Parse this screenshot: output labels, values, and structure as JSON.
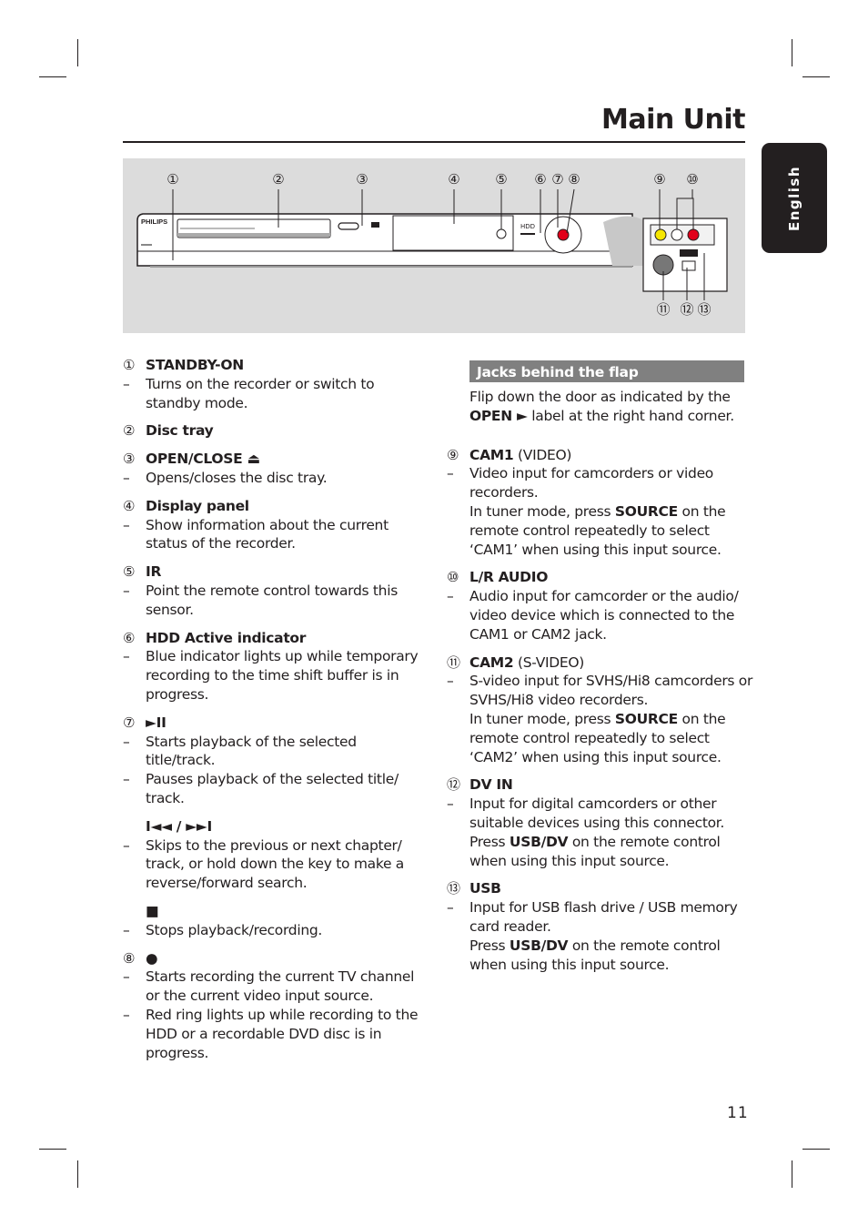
{
  "page": {
    "title": "Main Unit",
    "language_tab": "English",
    "page_number": "11"
  },
  "figure": {
    "brand": "PHILIPS",
    "callouts": [
      "①",
      "②",
      "③",
      "④",
      "⑤",
      "⑥",
      "⑦",
      "⑧",
      "⑨",
      "⑩",
      "⑪",
      "⑫",
      "⑬"
    ],
    "colors": {
      "background": "#dcdcdc",
      "video_jack": "#f5e600",
      "audio_left_jack": "#ffffff",
      "audio_right_jack": "#e2001a",
      "record_button": "#e2001a"
    }
  },
  "left_column": {
    "items": [
      {
        "num": "①",
        "heading": "STANDBY-ON",
        "lines": [
          "Turns on the recorder or switch to standby mode."
        ]
      },
      {
        "num": "②",
        "heading": "Disc tray",
        "lines": []
      },
      {
        "num": "③",
        "heading": "OPEN/CLOSE ⏏",
        "lines": [
          "Opens/closes the disc tray."
        ]
      },
      {
        "num": "④",
        "heading": "Display panel",
        "lines": [
          "Show information about the current status of the recorder."
        ]
      },
      {
        "num": "⑤",
        "heading": "IR",
        "lines": [
          "Point the remote control towards this sensor."
        ]
      },
      {
        "num": "⑥",
        "heading": "HDD Active indicator",
        "lines": [
          "Blue indicator lights up while  temporary recording to the time shift buffer is in progress."
        ]
      },
      {
        "num": "⑦",
        "heading": "►II",
        "lines": [
          "Starts playback of the selected title/track.",
          "Pauses playback of the selected title/ track."
        ],
        "sub1_heading": "I◄◄ / ►►I",
        "sub1_lines": [
          "Skips to the previous or next chapter/ track, or hold down the key to make a reverse/forward search."
        ],
        "sub2_heading": "■",
        "sub2_lines": [
          "Stops playback/recording."
        ]
      },
      {
        "num": "⑧",
        "heading": "●",
        "lines": [
          "Starts recording the current TV channel or the current video input source.",
          "Red ring lights up while recording to the HDD or a recordable DVD disc is in progress."
        ]
      }
    ]
  },
  "right_column": {
    "section_title": "Jacks behind the flap",
    "intro_pre": "Flip down the door as indicated by the",
    "intro_bold": "OPEN ►",
    "intro_post": " label at the right hand corner.",
    "items": [
      {
        "num": "⑨",
        "heading": "CAM1",
        "heading_plain": " (VIDEO)",
        "line": "Video input for camcorders or video recorders.",
        "note_pre": "In tuner mode, press ",
        "note_bold": "SOURCE",
        "note_post": " on the remote control repeatedly to select ‘CAM1’ when using this input source."
      },
      {
        "num": "⑩",
        "heading": "L/R AUDIO",
        "heading_plain": "",
        "line": "Audio input for camcorder or the audio/ video device which is connected to the CAM1 or CAM2 jack."
      },
      {
        "num": "⑪",
        "heading": "CAM2",
        "heading_plain": " (S-VIDEO)",
        "line": "S-video input for SVHS/Hi8 camcorders or SVHS/Hi8 video recorders.",
        "note_pre": "In tuner mode, press ",
        "note_bold": "SOURCE",
        "note_post": " on the remote control repeatedly to select ‘CAM2’ when using this input source."
      },
      {
        "num": "⑫",
        "heading": "DV IN",
        "heading_plain": "",
        "line": "Input for digital camcorders or other suitable devices using this connector.",
        "note_pre": "Press ",
        "note_bold": "USB/DV",
        "note_post": " on the remote control when using this input source."
      },
      {
        "num": "⑬",
        "heading": "USB",
        "heading_plain": "",
        "line": "Input for USB flash drive / USB memory card reader.",
        "note_pre": "Press ",
        "note_bold": "USB/DV",
        "note_post": " on the remote control when using this input source."
      }
    ]
  }
}
